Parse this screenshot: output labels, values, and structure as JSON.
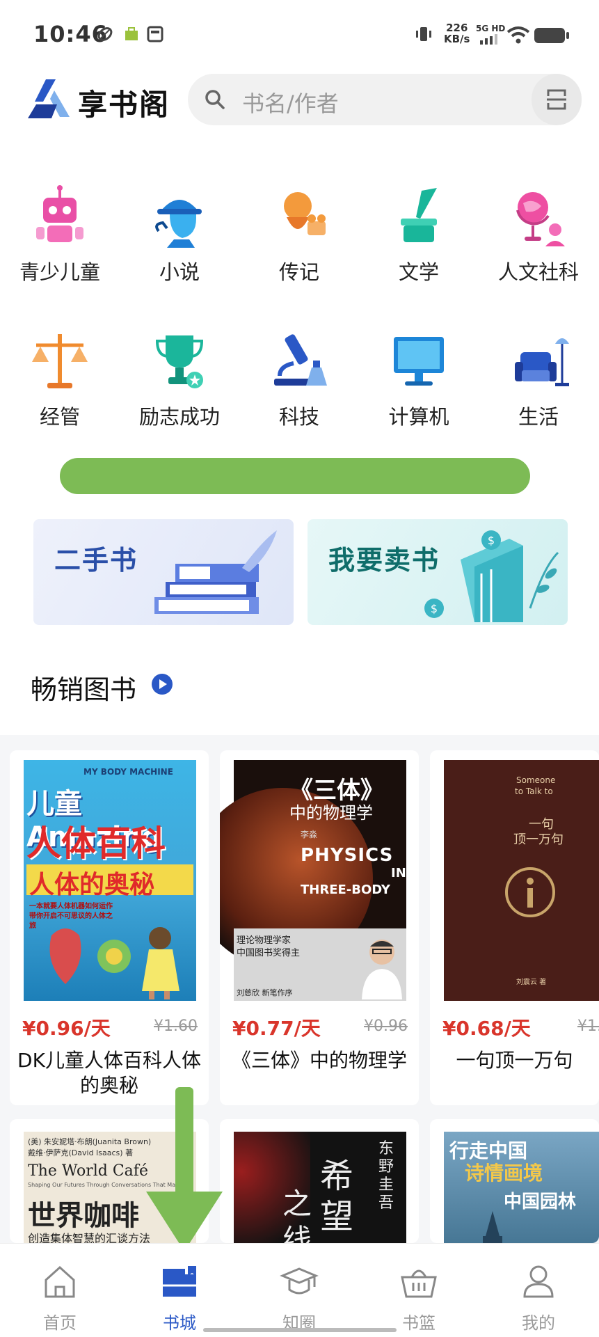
{
  "status": {
    "time": "10:46",
    "net_speed": "226",
    "net_unit": "KB/s",
    "net_type": "5G HD"
  },
  "header": {
    "brand": "享书阁",
    "search_placeholder": "书名/作者"
  },
  "categories": [
    {
      "label": "青少儿童",
      "icon": "robot-icon"
    },
    {
      "label": "小说",
      "icon": "detective-icon"
    },
    {
      "label": "传记",
      "icon": "portrait-icon"
    },
    {
      "label": "文学",
      "icon": "ink-pen-icon"
    },
    {
      "label": "人文社科",
      "icon": "globe-icon"
    },
    {
      "label": "经管",
      "icon": "scales-icon"
    },
    {
      "label": "励志成功",
      "icon": "trophy-icon"
    },
    {
      "label": "科技",
      "icon": "microscope-icon"
    },
    {
      "label": "计算机",
      "icon": "monitor-icon"
    },
    {
      "label": "生活",
      "icon": "armchair-icon"
    }
  ],
  "banners": [
    {
      "title": "二手书",
      "color": "#2a4fa8"
    },
    {
      "title": "我要卖书",
      "color": "#0f6d6a"
    }
  ],
  "section": {
    "title": "畅销图书"
  },
  "books": [
    {
      "price": "¥0.96/天",
      "orig": "¥1.60",
      "title": "DK儿童人体百科人体的奥秘",
      "cover": {
        "top": "MY BODY MACHINE",
        "l1": "儿童Amazing",
        "l2": "人体百科",
        "l3": "人体的奥秘",
        "l4": "一本就要人体机器如何运作 带你开启不可思议的人体之旅"
      }
    },
    {
      "price": "¥0.77/天",
      "orig": "¥0.96",
      "title": "《三体》中的物理学",
      "cover": {
        "l1": "《三体》",
        "l2": "中的物理学",
        "l3": "PHYSICS",
        "l4": "IN",
        "l5": "THREE-BODY",
        "author": "李淼",
        "blurb1": "理论物理学家",
        "blurb2": "中国图书奖得主",
        "blurb3": "刘慈欣 新笔作序"
      }
    },
    {
      "price": "¥0.68/天",
      "orig": "¥1.",
      "title": "一句顶一万句",
      "cover": {
        "en1": "Someone",
        "en2": "to Talk to",
        "cn1": "一句",
        "cn2": "顶一万句",
        "author": "刘震云 著"
      }
    }
  ],
  "books_row2": [
    {
      "cover": {
        "l0": "(美) 朱安妮塔·布朗(Juanita Brown)",
        "l0b": "戴维·伊萨克(David Isaacs) 著",
        "en": "The World Café",
        "sub": "Shaping Our Futures Through Conversations That Matter",
        "cn": "世界咖啡",
        "cn2": "创造集体智慧的汇谈方法"
      }
    },
    {
      "cover": {
        "author": "东野圭吾",
        "t1": "希",
        "t2": "望",
        "t3": "之",
        "t4": "线"
      }
    },
    {
      "cover": {
        "t1": "行走中国",
        "t2": "诗情画境",
        "t3": "中国园林"
      }
    }
  ],
  "nav": [
    {
      "label": "首页",
      "icon": "home-icon"
    },
    {
      "label": "书城",
      "icon": "bookstore-icon"
    },
    {
      "label": "知圈",
      "icon": "graduation-cap-icon"
    },
    {
      "label": "书篮",
      "icon": "basket-icon"
    },
    {
      "label": "我的",
      "icon": "user-icon"
    }
  ],
  "colors": {
    "accent": "#2a58c6",
    "price": "#d9352b",
    "green": "#7dbb55"
  }
}
